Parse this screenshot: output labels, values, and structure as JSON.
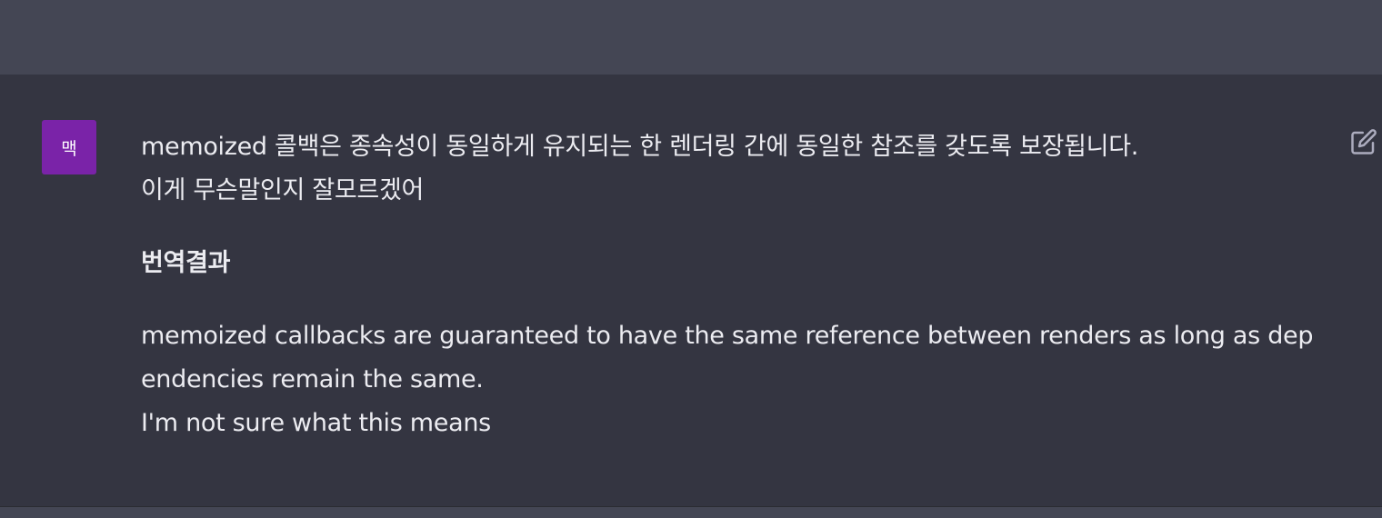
{
  "message": {
    "avatar_initial": "맥",
    "original_lines": [
      "memoized 콜백은 종속성이 동일하게 유지되는 한 렌더링 간에 동일한 참조를 갖도록 보장됩니다.",
      "이게 무슨말인지 잘모르겠어"
    ],
    "translation_heading": "번역결과",
    "translation_lines": [
      "memoized callbacks are guaranteed to have the same reference between renders as long as dependencies remain the same.",
      "I'm not sure what this means"
    ],
    "edit_icon": "edit-icon"
  },
  "colors": {
    "top_band": "#444654",
    "message_background": "#343541",
    "avatar": "#7a23a8",
    "text": "#ececf1",
    "icon": "#acacbe"
  }
}
